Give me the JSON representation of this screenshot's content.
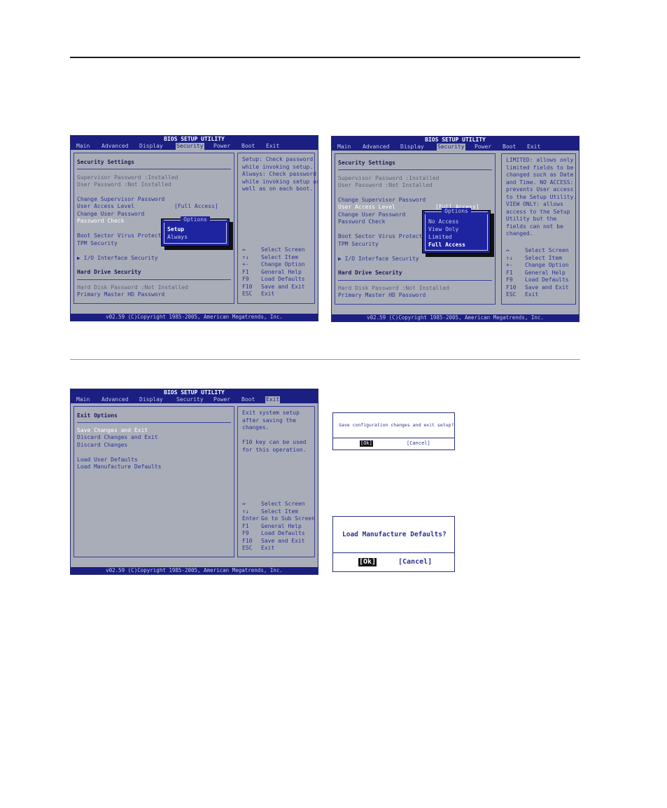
{
  "bios_title": "BIOS SETUP UTILITY",
  "copyright": "v02.59 (C)Copyright 1985-2005, American Megatrends, Inc.",
  "menu": [
    "Main",
    "Advanced",
    "Display",
    "Security",
    "Power",
    "Boot",
    "Exit"
  ],
  "keys": [
    {
      "key": "↔",
      "desc": "Select Screen"
    },
    {
      "key": "↑↓",
      "desc": "Select Item"
    },
    {
      "key": "+-",
      "desc": "Change Option"
    },
    {
      "key": "F1",
      "desc": "General Help"
    },
    {
      "key": "F9",
      "desc": "Load Defaults"
    },
    {
      "key": "F10",
      "desc": "Save and Exit"
    },
    {
      "key": "ESC",
      "desc": "Exit"
    }
  ],
  "exit_keys": [
    {
      "key": "↔",
      "desc": "Select Screen"
    },
    {
      "key": "↑↓",
      "desc": "Select Item"
    },
    {
      "key": "Enter",
      "desc": "Go to Sub Screen"
    },
    {
      "key": "F1",
      "desc": "General Help"
    },
    {
      "key": "F9",
      "desc": "Load Defaults"
    },
    {
      "key": "F10",
      "desc": "Save and Exit"
    },
    {
      "key": "ESC",
      "desc": "Exit"
    }
  ],
  "security": {
    "heading": "Security Settings",
    "supervisor_password": "Supervisor Password :Installed",
    "user_password": "User Password       :Not Installed",
    "change_supervisor": "Change Supervisor Password",
    "user_access_level": "User Access Level",
    "user_access_value": "[Full Access]",
    "change_user": "Change User Password",
    "password_check": "Password Check",
    "boot_sector": "Boot Sector Virus Protection",
    "tpm": "TPM Security",
    "io_interface": "▶ I/O Interface Security",
    "hdd_heading": "Hard Drive Security",
    "hard_disk_password": "Hard Disk Password  :Not Installed",
    "primary_master": "Primary Master HD Password"
  },
  "screen1": {
    "help": "Setup: Check password while invoking setup. Always: Check password while invoking setup as well as on each boot.",
    "popup_title": "Options",
    "options": [
      "Setup",
      "Always"
    ]
  },
  "screen2": {
    "help": "LIMITED: allows only limited fields to be changed such as Date and Time. NO ACCESS: prevents User access to the Setup Utility. VIEW ONLY: allows access to the Setup Utility but the fields can not be changed.",
    "popup_title": "Options",
    "options": [
      "No Access",
      "View Only",
      "Limited",
      "Full Access"
    ]
  },
  "screen3": {
    "heading": "Exit Options",
    "items": [
      "Save Changes and Exit",
      "Discard Changes and Exit",
      "Discard Changes",
      "Load User Defaults",
      "Load Manufacture Defaults"
    ],
    "help": "Exit system setup after saving the changes.",
    "help2": "F10 key can be used for this operation."
  },
  "dialog1": {
    "message": "Save configuration changes and exit setup?",
    "ok": "[Ok]",
    "cancel": "[Cancel]"
  },
  "dialog2": {
    "message": "Load Manufacture Defaults?",
    "ok": "[Ok]",
    "cancel": "[Cancel]"
  }
}
